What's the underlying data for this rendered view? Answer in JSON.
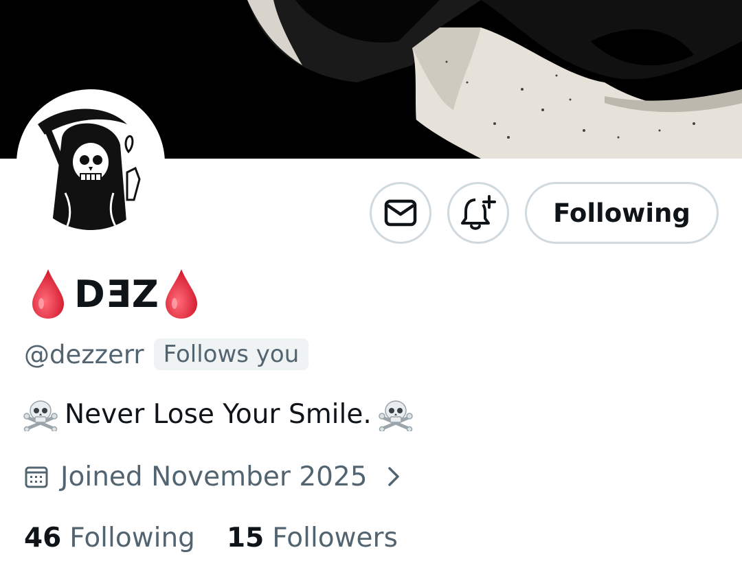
{
  "profile": {
    "display_name": "DƎZ",
    "handle": "@dezzerr",
    "follows_you_badge": "Follows you",
    "bio": "Never Lose Your Smile.",
    "joined": "Joined November 2025"
  },
  "actions": {
    "message_icon": "envelope-icon",
    "notify_icon": "bell-plus-icon",
    "follow_label": "Following"
  },
  "stats": {
    "following_count": "46",
    "following_label": "Following",
    "followers_count": "15",
    "followers_label": "Followers"
  },
  "colors": {
    "text_primary": "#0f1419",
    "text_secondary": "#536471",
    "button_border": "#cfd9de",
    "badge_bg": "#eff3f4",
    "drop_red": "#e0283a"
  }
}
